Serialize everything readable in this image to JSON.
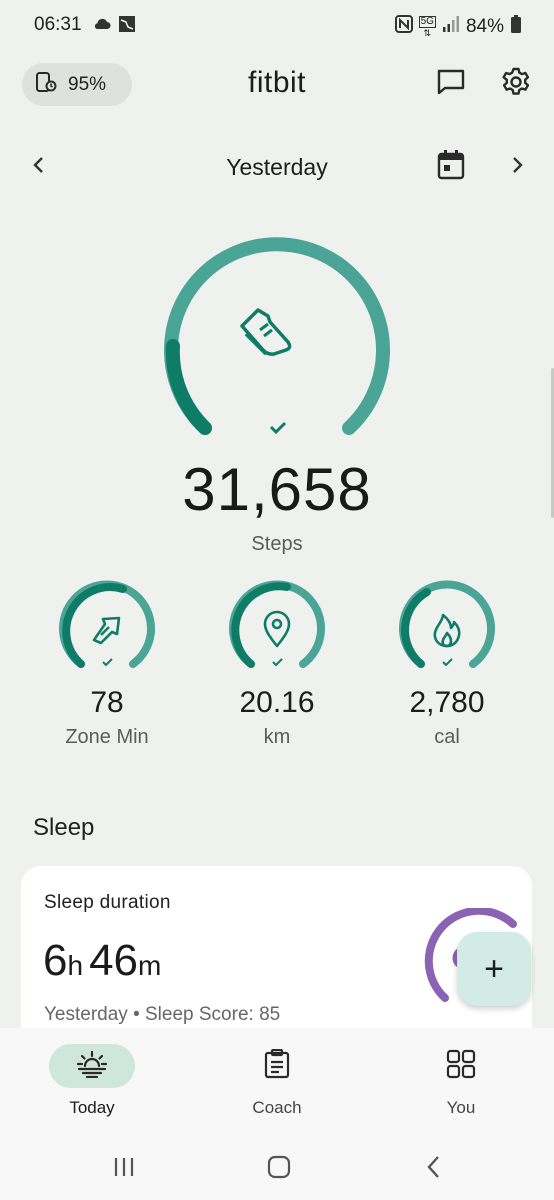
{
  "status_bar": {
    "time": "06:31",
    "battery_percent": "84%",
    "network": "5G",
    "left_icons": [
      "cloud-icon",
      "gallery-icon"
    ],
    "right_icons": [
      "nfc-icon",
      "network-icon",
      "signal-icon",
      "battery-icon"
    ]
  },
  "header": {
    "device_battery": "95%",
    "title": "fitbit",
    "icons": [
      "device-battery-icon",
      "chat-icon",
      "settings-icon"
    ]
  },
  "date_nav": {
    "label": "Yesterday",
    "icons": [
      "chevron-left-icon",
      "calendar-icon",
      "chevron-right-icon"
    ]
  },
  "steps": {
    "value": "31,658",
    "label": "Steps",
    "goal_met": true,
    "icon": "shoe-icon"
  },
  "stats": [
    {
      "value": "78",
      "label": "Zone Min",
      "icon": "zone-arrow-icon",
      "goal_met": true
    },
    {
      "value": "20.16",
      "label": "km",
      "icon": "location-pin-icon",
      "goal_met": true
    },
    {
      "value": "2,780",
      "label": "cal",
      "icon": "flame-icon",
      "goal_met": true
    }
  ],
  "sleep": {
    "section_title": "Sleep",
    "card_title": "Sleep duration",
    "hours": "6",
    "hours_unit": "h",
    "minutes": "46",
    "minutes_unit": "m",
    "subtitle": "Yesterday • Sleep Score: 85"
  },
  "fab": {
    "label": "+"
  },
  "bottom_nav": {
    "items": [
      {
        "label": "Today",
        "icon": "sunrise-icon",
        "active": true
      },
      {
        "label": "Coach",
        "icon": "clipboard-icon",
        "active": false
      },
      {
        "label": "You",
        "icon": "grid-icon",
        "active": false
      }
    ]
  },
  "system_nav": [
    "recents-icon",
    "home-icon",
    "back-icon"
  ],
  "colors": {
    "teal_primary": "#4aa597",
    "teal_dark": "#0f7c68",
    "sleep_purple": "#8a63b3",
    "background": "#eff1ef",
    "nav_active": "#cfe6dd"
  }
}
